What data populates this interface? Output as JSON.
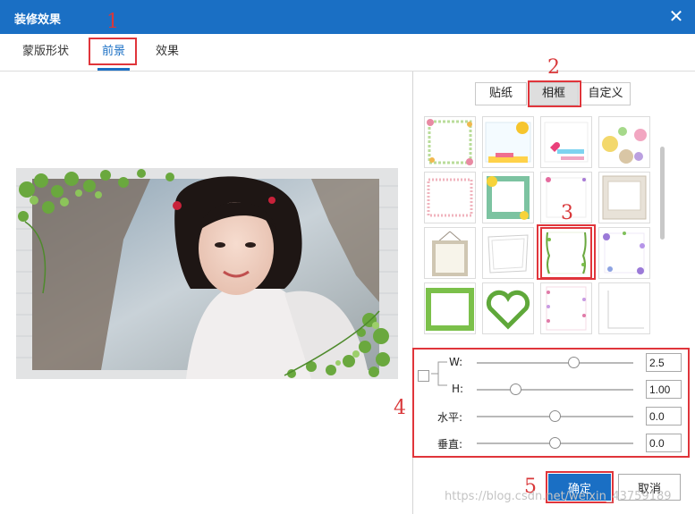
{
  "window": {
    "title": "装修效果",
    "close_glyph": "✕"
  },
  "tabs": [
    {
      "label": "蒙版形状",
      "active": false
    },
    {
      "label": "前景",
      "active": true
    },
    {
      "label": "效果",
      "active": false
    }
  ],
  "accent_color": "#1a6fc4",
  "annotation_color": "#e0353b",
  "annotations": [
    "1",
    "2",
    "3",
    "4",
    "5"
  ],
  "categories": [
    {
      "label": "贴纸",
      "active": false
    },
    {
      "label": "相框",
      "active": true
    },
    {
      "label": "自定义",
      "active": false
    }
  ],
  "frames": [
    {
      "icon": "floral-corner-frame-icon"
    },
    {
      "icon": "sun-cloud-frame-icon"
    },
    {
      "icon": "heart-ribbon-frame-icon"
    },
    {
      "icon": "butterfly-collage-frame-icon"
    },
    {
      "icon": "pink-lace-frame-icon"
    },
    {
      "icon": "emoji-green-frame-icon"
    },
    {
      "icon": "corner-flower-frame-icon"
    },
    {
      "icon": "polaroid-frame-icon"
    },
    {
      "icon": "hanging-frame-icon"
    },
    {
      "icon": "sketch-frame-icon"
    },
    {
      "icon": "vine-frame-icon",
      "selected": true
    },
    {
      "icon": "purple-flower-frame-icon"
    },
    {
      "icon": "green-leaf-frame-icon"
    },
    {
      "icon": "heart-leaf-frame-icon"
    },
    {
      "icon": "pink-floral-border-icon"
    },
    {
      "icon": "thin-line-frame-icon"
    }
  ],
  "sliders": [
    {
      "label": "W:",
      "value": "2.5",
      "position": 0.62
    },
    {
      "label": "H:",
      "value": "1.00",
      "position": 0.25
    },
    {
      "label": "水平:",
      "value": "0.0",
      "position": 0.5
    },
    {
      "label": "垂直:",
      "value": "0.0",
      "position": 0.5
    }
  ],
  "buttons": {
    "ok": "确定",
    "cancel": "取消"
  },
  "watermark": "https://blog.csdn.net/weixin_43759189"
}
